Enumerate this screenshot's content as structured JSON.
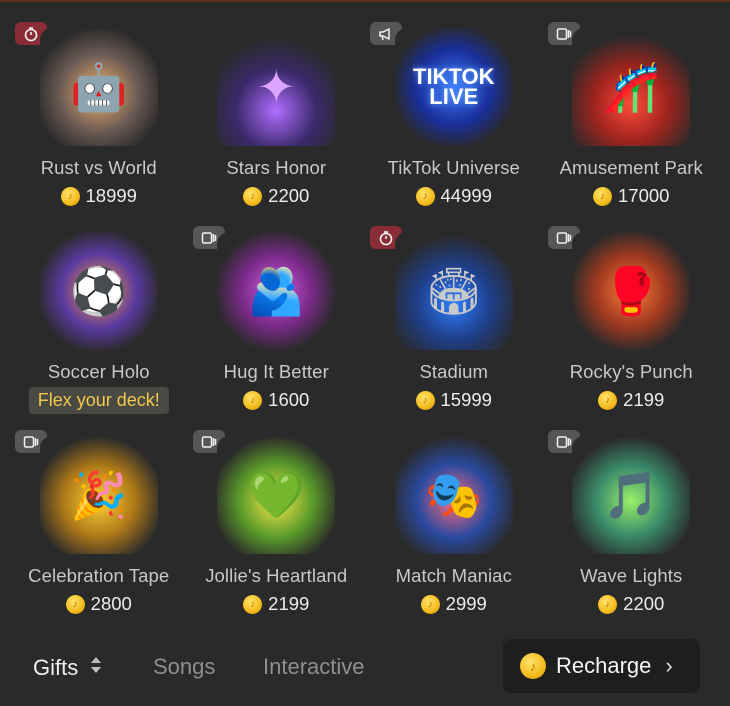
{
  "gifts": [
    {
      "name": "Rust vs World",
      "price": "18999",
      "badge": "timer",
      "badge_icon": "timer-icon",
      "art_glyph": "🤖"
    },
    {
      "name": "Stars Honor",
      "price": "2200",
      "badge": "",
      "badge_icon": "",
      "art_glyph": "✦"
    },
    {
      "name": "TikTok Universe",
      "price": "44999",
      "badge": "megaphone",
      "badge_icon": "megaphone-icon",
      "art_text": "TIKTOK LIVE"
    },
    {
      "name": "Amusement Park",
      "price": "17000",
      "badge": "video",
      "badge_icon": "video-gift-icon",
      "art_glyph": "🎢"
    },
    {
      "name": "Soccer Holo",
      "price": "",
      "badge": "",
      "badge_icon": "",
      "art_glyph": "⚽",
      "promo": "Flex your deck!"
    },
    {
      "name": "Hug It Better",
      "price": "1600",
      "badge": "video",
      "badge_icon": "video-gift-icon",
      "art_glyph": "🫂"
    },
    {
      "name": "Stadium",
      "price": "15999",
      "badge": "timer",
      "badge_icon": "timer-icon",
      "art_glyph": "🏟"
    },
    {
      "name": "Rocky's Punch",
      "price": "2199",
      "badge": "video",
      "badge_icon": "video-gift-icon",
      "art_glyph": "🥊"
    },
    {
      "name": "Celebration Tape",
      "price": "2800",
      "badge": "video",
      "badge_icon": "video-gift-icon",
      "art_glyph": "🎉"
    },
    {
      "name": "Jollie's Heartland",
      "price": "2199",
      "badge": "video",
      "badge_icon": "video-gift-icon",
      "art_glyph": "💚"
    },
    {
      "name": "Match Maniac",
      "price": "2999",
      "badge": "",
      "badge_icon": "",
      "art_glyph": "🎭"
    },
    {
      "name": "Wave Lights",
      "price": "2200",
      "badge": "video",
      "badge_icon": "video-gift-icon",
      "art_glyph": "🎵"
    }
  ],
  "tabs": {
    "gifts": "Gifts",
    "songs": "Songs",
    "interactive": "Interactive"
  },
  "recharge_label": "Recharge",
  "colors": {
    "background": "#2a2a2a",
    "coin": "#f3bb1c",
    "promo_text": "#f2c94c",
    "timer_badge": "#8a2d36"
  }
}
